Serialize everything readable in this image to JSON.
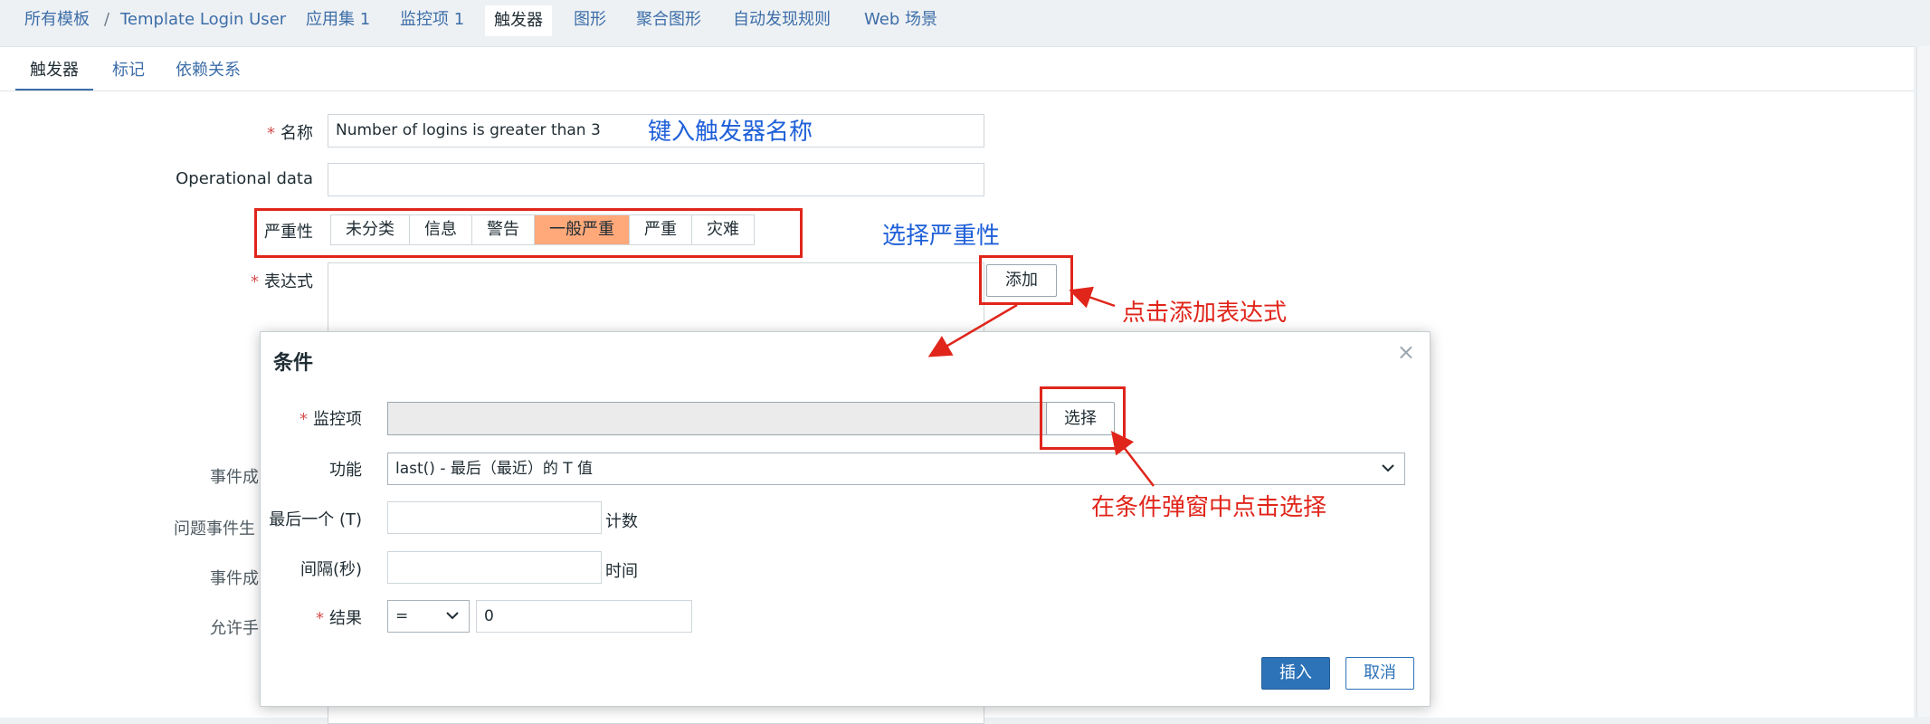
{
  "breadcrumb": {
    "items": [
      "所有模板",
      "Template Login User",
      "应用集 1",
      "监控项 1",
      "触发器",
      "图形",
      "聚合图形",
      "自动发现规则",
      "Web 场景"
    ],
    "separator": "/"
  },
  "tabs": [
    "触发器",
    "标记",
    "依赖关系"
  ],
  "form": {
    "name_label": "名称",
    "name_value": "Number of logins is greater than 3",
    "opdata_label": "Operational data",
    "severity_label": "严重性",
    "severity_options": [
      "未分类",
      "信息",
      "警告",
      "一般严重",
      "严重",
      "灾难"
    ],
    "severity_selected": "一般严重",
    "expression_label": "表达式",
    "add_button": "添加",
    "faded_labels": [
      "事件成",
      "问题事件生",
      "事件成",
      "允许手"
    ]
  },
  "dialog": {
    "title": "条件",
    "close": "×",
    "item_label": "监控项",
    "select_button": "选择",
    "function_label": "功能",
    "function_value": "last() - 最后（最近）的 T 值",
    "last_label": "最后一个 (T)",
    "last_unit": "计数",
    "interval_label": "间隔(秒)",
    "interval_unit": "时间",
    "result_label": "结果",
    "result_operator": "=",
    "result_value": "0",
    "insert_button": "插入",
    "cancel_button": "取消"
  },
  "annotations": {
    "name_hint": "键入触发器名称",
    "severity_hint": "选择严重性",
    "add_hint": "点击添加表达式",
    "select_hint": "在条件弹窗中点击选择"
  },
  "colors": {
    "link": "#3d6ea8",
    "severity_selected": "#ffa97a",
    "annotation_red": "#e0251b",
    "annotation_blue": "#1e5fd8",
    "primary_button": "#2d73b8"
  }
}
